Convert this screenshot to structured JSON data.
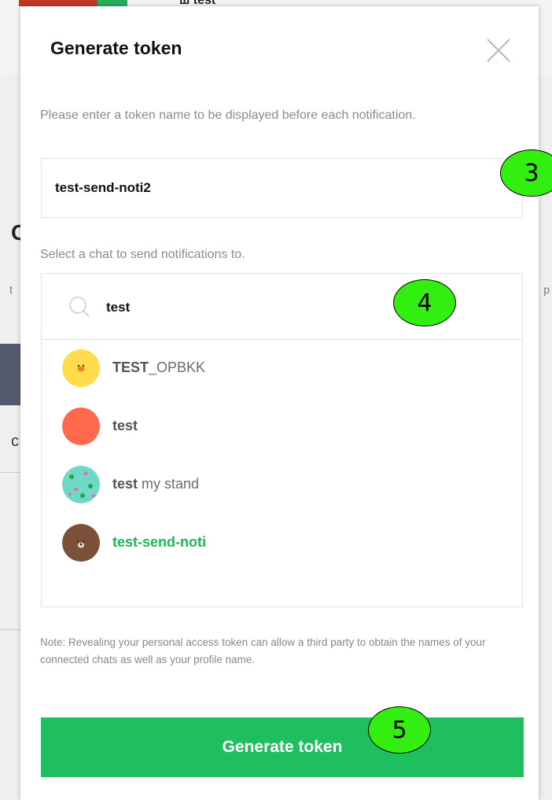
{
  "background": {
    "top_text": "ш test",
    "left_letter_1": "C",
    "left_letter_2": "t",
    "left_letter_3": "c",
    "right_letter": "p"
  },
  "modal": {
    "title": "Generate token",
    "description": "Please enter a token name to be displayed before each notification.",
    "token_name_value": "test-send-noti2",
    "select_label": "Select a chat to send notifications to.",
    "search": {
      "value": "test",
      "icon": "search-icon"
    },
    "chats": [
      {
        "match": "TEST",
        "rest": "_OPBKK",
        "selected": false,
        "avatar": "sally-chick-icon"
      },
      {
        "match": "test",
        "rest": "",
        "selected": false,
        "avatar": "orange-circle-avatar"
      },
      {
        "match": "test",
        "rest": " my stand",
        "selected": false,
        "avatar": "teal-pattern-avatar"
      },
      {
        "match": "test-send-noti",
        "rest": "",
        "selected": true,
        "avatar": "brown-bear-icon"
      }
    ],
    "note": "Note: Revealing your personal access token can allow a third party to obtain the names of your connected chats as well as your profile name.",
    "generate_button": "Generate token"
  },
  "markers": {
    "m3": "3",
    "m4": "4",
    "m5": "5"
  },
  "colors": {
    "accent_green": "#1fbf5f",
    "selected_text": "#1db954",
    "marker_green": "#33ee11"
  }
}
